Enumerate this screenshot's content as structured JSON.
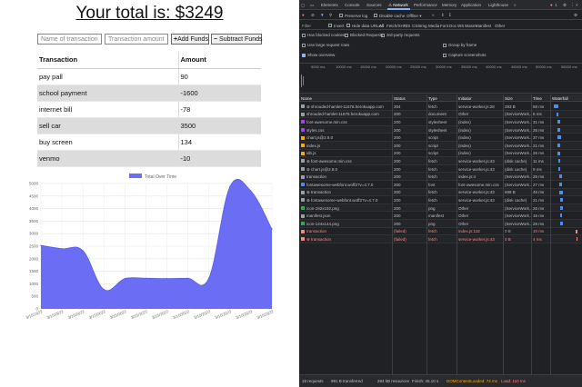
{
  "app": {
    "total_text": "Your total is: $3249",
    "name_placeholder": "Name of transaction",
    "amount_placeholder": "Transaction amount",
    "add_label": "Add Funds",
    "subtract_label": "Subtract Funds",
    "table_headers": [
      "Transaction",
      "Amount"
    ],
    "rows": [
      {
        "name": "pay pall",
        "amount": "90"
      },
      {
        "name": "school payment",
        "amount": "-1600"
      },
      {
        "name": "internet bill",
        "amount": "-78"
      },
      {
        "name": "sell car",
        "amount": "3500"
      },
      {
        "name": "buy screen",
        "amount": "134"
      },
      {
        "name": "venmo",
        "amount": "-10"
      }
    ]
  },
  "chart_data": {
    "type": "area",
    "legend": "Total Over Time",
    "ylim": [
      0,
      5000
    ],
    "yticks": [
      "0",
      "500",
      "1000",
      "1500",
      "2000",
      "2500",
      "3000",
      "3500",
      "4000",
      "4500",
      "5000"
    ],
    "x": [
      "3/15/2022",
      "3/15/2022",
      "3/15/2022",
      "3/15/2022",
      "3/15/2022",
      "3/15/2022",
      "3/15/2022",
      "3/15/2022",
      "3/15/2022",
      "3/15/2022",
      "3/15/2022",
      "3/15/2022"
    ],
    "values": [
      2530,
      2400,
      2320,
      770,
      1210,
      1220,
      1210,
      1220,
      1230,
      4870,
      4700,
      3180
    ],
    "color": "#6b6ef5"
  },
  "devtools": {
    "tabs": [
      "Elements",
      "Console",
      "Sources",
      "Network",
      "Performance",
      "Memory",
      "Application",
      "Lighthouse"
    ],
    "active_tab": "Network",
    "issues_count": "1",
    "preserve_log": "Preserve log",
    "disable_cache": "Disable cache",
    "throttle": "Offline",
    "filter_placeholder": "Filter",
    "invert": "Invert",
    "hide_data_urls": "Hide data URLs",
    "type_filters": [
      "All",
      "Fetch/XHR",
      "JS",
      "CSS",
      "Img",
      "Media",
      "Font",
      "Doc",
      "WS",
      "Wasm",
      "Manifest",
      "Other"
    ],
    "has_blocked_cookies": "Has blocked cookies",
    "blocked_requests": "Blocked Requests",
    "third_party": "3rd-party requests",
    "large_rows": "Use large request rows",
    "group_by_frame": "Group by frame",
    "show_overview": "Show overview",
    "capture_screenshots": "Capture screenshots",
    "timeline_ticks": [
      "5000 ms",
      "10000 ms",
      "15000 ms",
      "20000 ms",
      "25000 ms",
      "30000 ms",
      "35000 ms",
      "40000 ms",
      "45000 ms",
      "50000 ms",
      "55000 ms"
    ],
    "columns": [
      "Name",
      "Status",
      "Type",
      "Initiator",
      "Size",
      "Time",
      "Waterfall"
    ],
    "requests": [
      {
        "name": "⊗ shrouded-hamlet-11676.herokuapp.com",
        "status": "304",
        "type": "fetch",
        "initiator": "service-worker.js:28",
        "size": "293 B",
        "time": "58 ms",
        "err": false,
        "icon": "#9aa0a6",
        "bar": [
          2,
          5
        ]
      },
      {
        "name": "shrouded-hamlet-11676.herokuapp.com",
        "status": "200",
        "type": "document",
        "initiator": "Other",
        "size": "(ServiceWork...",
        "time": "6 ms",
        "err": false,
        "icon": "#9aa0a6",
        "bar": [
          5,
          2
        ]
      },
      {
        "name": "font-awesome.min.css",
        "status": "200",
        "type": "stylesheet",
        "initiator": "(index)",
        "size": "(ServiceWork...",
        "time": "31 ms",
        "err": false,
        "icon": "#a142f4",
        "bar": [
          6,
          3
        ]
      },
      {
        "name": "styles.css",
        "status": "200",
        "type": "stylesheet",
        "initiator": "(index)",
        "size": "(ServiceWork...",
        "time": "26 ms",
        "err": false,
        "icon": "#a142f4",
        "bar": [
          6,
          3
        ]
      },
      {
        "name": "chart.js@2.8.0",
        "status": "200",
        "type": "script",
        "initiator": "(index)",
        "size": "(ServiceWork...",
        "time": "37 ms",
        "err": false,
        "icon": "#f9ab00",
        "bar": [
          6,
          4
        ]
      },
      {
        "name": "index.js",
        "status": "200",
        "type": "script",
        "initiator": "(index)",
        "size": "(ServiceWork...",
        "time": "21 ms",
        "err": false,
        "icon": "#f9ab00",
        "bar": [
          6,
          3
        ]
      },
      {
        "name": "idb.js",
        "status": "200",
        "type": "script",
        "initiator": "(index)",
        "size": "(ServiceWork...",
        "time": "26 ms",
        "err": false,
        "icon": "#f9ab00",
        "bar": [
          6,
          3
        ]
      },
      {
        "name": "⊗ font-awesome.min.css",
        "status": "200",
        "type": "fetch",
        "initiator": "service-worker.js:43",
        "size": "(disk cache)",
        "time": "11 ms",
        "err": false,
        "icon": "#9aa0a6",
        "bar": [
          7,
          2
        ]
      },
      {
        "name": "⊗ chart.js@2.8.0",
        "status": "200",
        "type": "fetch",
        "initiator": "service-worker.js:43",
        "size": "(disk cache)",
        "time": "9 ms",
        "err": false,
        "icon": "#9aa0a6",
        "bar": [
          7,
          2
        ]
      },
      {
        "name": "transaction",
        "status": "200",
        "type": "fetch",
        "initiator": "index.js:4",
        "size": "(ServiceWork...",
        "time": "26 ms",
        "err": false,
        "icon": "#9aa0a6",
        "bar": [
          8,
          3
        ]
      },
      {
        "name": "fontawesome-webfont.woff2?v=4.7.0",
        "status": "200",
        "type": "font",
        "initiator": "font-awesome.min.css",
        "size": "(ServiceWork...",
        "time": "27 ms",
        "err": false,
        "icon": "#4e8cf0",
        "bar": [
          8,
          3
        ]
      },
      {
        "name": "⊗ transaction",
        "status": "200",
        "type": "fetch",
        "initiator": "service-worker.js:43",
        "size": "698 B",
        "time": "45 ms",
        "err": false,
        "icon": "#9aa0a6",
        "bar": [
          8,
          4
        ]
      },
      {
        "name": "⊗ fontawesome-webfont.woff2?v=4.7.0",
        "status": "200",
        "type": "fetch",
        "initiator": "service-worker.js:43",
        "size": "(disk cache)",
        "time": "21 ms",
        "err": false,
        "icon": "#9aa0a6",
        "bar": [
          9,
          3
        ]
      },
      {
        "name": "icon-192x192.png",
        "status": "200",
        "type": "png",
        "initiator": "Other",
        "size": "(ServiceWork...",
        "time": "26 ms",
        "err": false,
        "icon": "#34a853",
        "bar": [
          9,
          3
        ]
      },
      {
        "name": "manifest.json",
        "status": "200",
        "type": "manifest",
        "initiator": "Other",
        "size": "(ServiceWork...",
        "time": "16 ms",
        "err": false,
        "icon": "#9aa0a6",
        "bar": [
          9,
          2
        ]
      },
      {
        "name": "icon-144x144.png",
        "status": "200",
        "type": "png",
        "initiator": "Other",
        "size": "(ServiceWork...",
        "time": "26 ms",
        "err": false,
        "icon": "#34a853",
        "bar": [
          9,
          3
        ]
      },
      {
        "name": "transaction",
        "status": "(failed)",
        "type": "fetch",
        "initiator": "index.js:118",
        "size": "0 B",
        "time": "10 ms",
        "err": true,
        "icon": "#f28b82",
        "bar": [
          26,
          2
        ]
      },
      {
        "name": "⊗ transaction",
        "status": "(failed)",
        "type": "fetch",
        "initiator": "service-worker.js:43",
        "size": "0 B",
        "time": "4 ms",
        "err": true,
        "icon": "#f28b82",
        "bar": [
          27,
          1
        ]
      }
    ],
    "status_bar": {
      "requests": "18 requests",
      "transferred": "991 B transferred",
      "resources": "284 kB resources",
      "finish": "Finish: 45.10 s",
      "dcl": "DOMContentLoaded: 74 ms",
      "load": "Load: 110 ms"
    }
  }
}
